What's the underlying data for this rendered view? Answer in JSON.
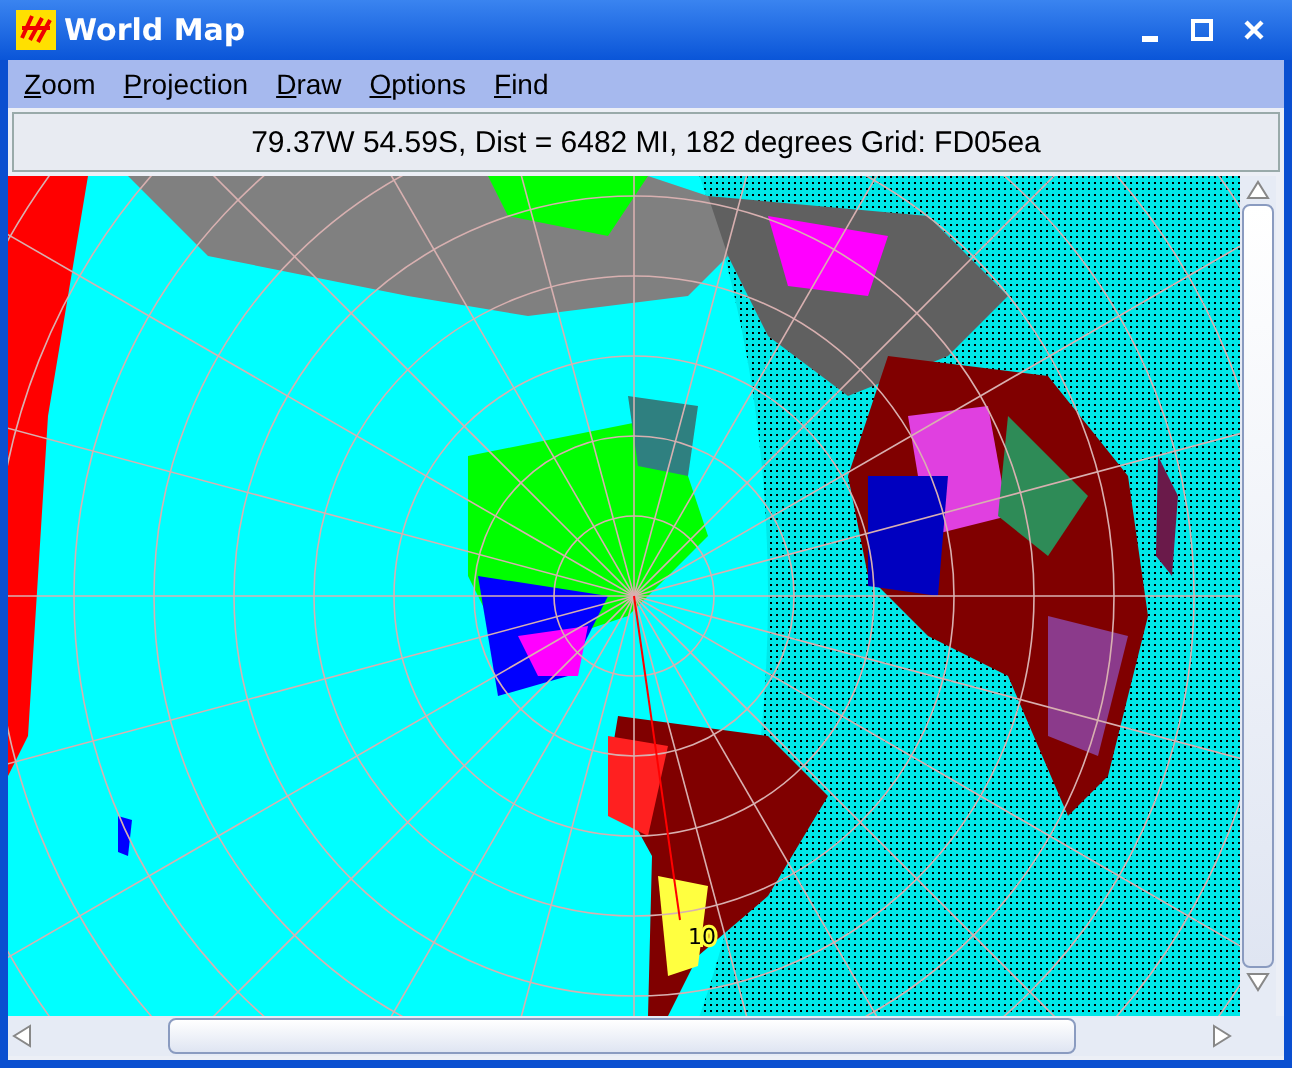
{
  "window": {
    "title": "World Map"
  },
  "menu": [
    {
      "label": "Zoom"
    },
    {
      "label": "Projection"
    },
    {
      "label": "Draw"
    },
    {
      "label": "Options"
    },
    {
      "label": "Find"
    }
  ],
  "status": "79.37W 54.59S, Dist = 6482 MI, 182 degrees Grid: FD05ea",
  "map": {
    "label": "10"
  }
}
